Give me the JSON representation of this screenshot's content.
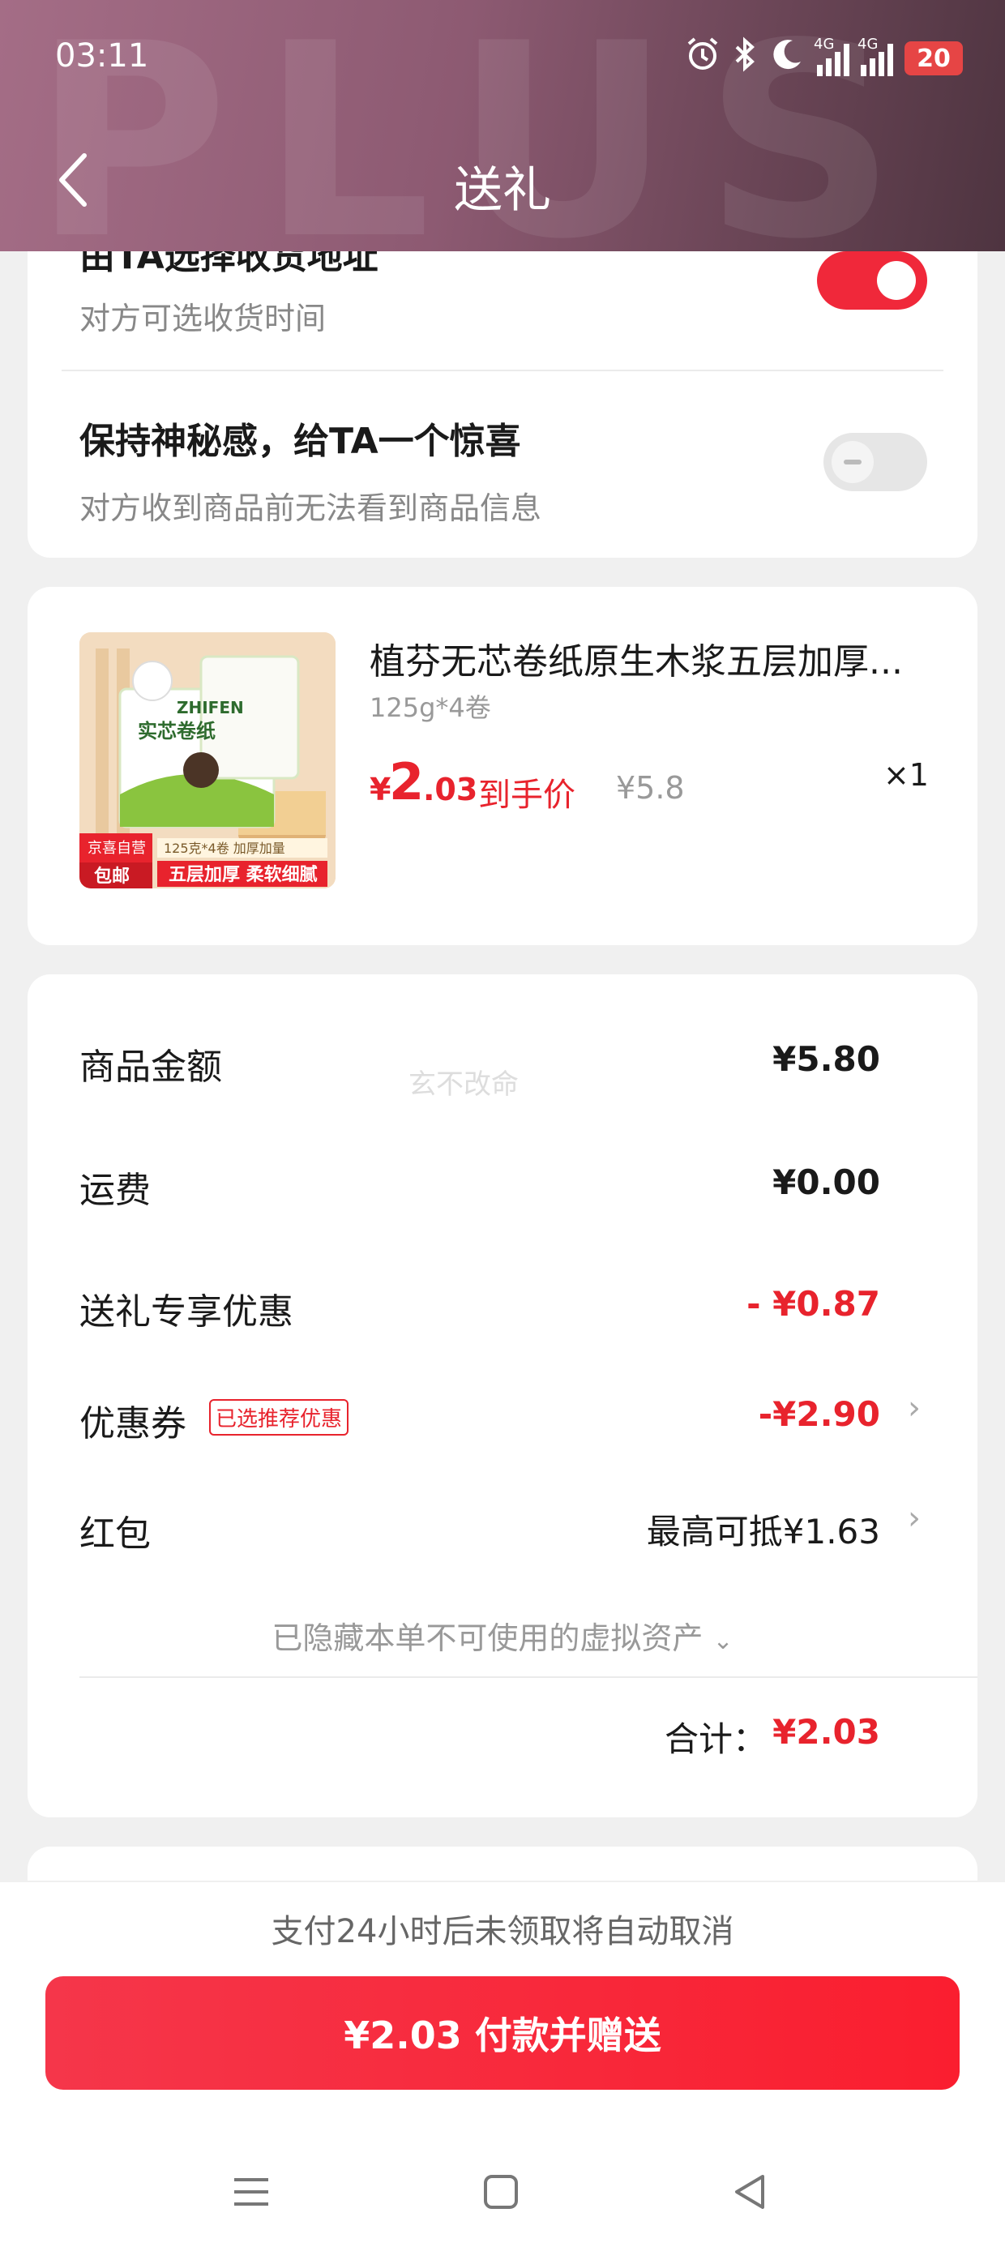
{
  "status_bar": {
    "time": "03:11",
    "network_label": "4G",
    "battery": "20"
  },
  "header": {
    "title": "送礼",
    "watermark": "PLUS"
  },
  "options": {
    "address_title": "由TA选择收货地址",
    "address_sub": "对方可选收货时间",
    "address_toggle_on": true,
    "surprise_title": "保持神秘感，给TA一个惊喜",
    "surprise_sub": "对方收到商品前无法看到商品信息",
    "surprise_toggle_on": false
  },
  "product": {
    "name": "植芬无芯卷纸原生木浆五层加厚...",
    "spec": "125g*4卷",
    "currency": "¥",
    "price_int": "2",
    "price_dec": ".03",
    "price_tag": "到手价",
    "original_price": "¥5.8",
    "quantity": "×1",
    "image": {
      "brand": "ZHIFEN",
      "name": "实芯卷纸",
      "badge_top": "京喜自营",
      "badge_bottom": "包邮",
      "spec_strip": "125克*4卷 加厚加量",
      "slogan": "五层加厚 柔软细腻"
    }
  },
  "fees": {
    "watermark": "玄不改命",
    "goods_label": "商品金额",
    "goods_value": "¥5.80",
    "shipping_label": "运费",
    "shipping_value": "¥0.00",
    "gift_discount_label": "送礼专享优惠",
    "gift_discount_value": "- ¥0.87",
    "coupon_label": "优惠券",
    "coupon_badge": "已选推荐优惠",
    "coupon_value": "-¥2.90",
    "hongbao_label": "红包",
    "hongbao_value": "最高可抵¥1.63",
    "hidden_assets": "已隐藏本单不可使用的虚拟资产",
    "total_label": "合计：",
    "total_value": "¥2.03"
  },
  "footer": {
    "notice": "支付24小时后未领取将自动取消",
    "pay_button": "¥2.03 付款并赠送"
  },
  "colors": {
    "accent_red": "#e8232d",
    "header_gradient_start": "#a46d86",
    "header_gradient_end": "#4e3440"
  }
}
